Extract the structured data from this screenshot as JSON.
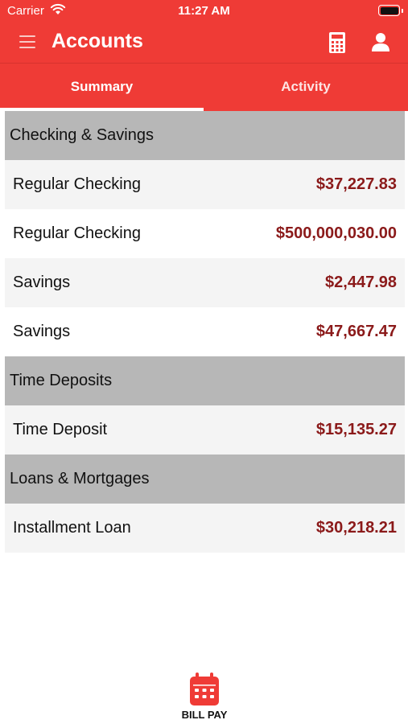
{
  "status_bar": {
    "carrier": "Carrier",
    "time": "11:27 AM"
  },
  "nav": {
    "title": "Accounts"
  },
  "tabs": [
    {
      "label": "Summary",
      "selected": true
    },
    {
      "label": "Activity",
      "selected": false
    }
  ],
  "sections": [
    {
      "title": "Checking & Savings",
      "rows": [
        {
          "name": "Regular Checking",
          "amount": "$37,227.83"
        },
        {
          "name": "Regular Checking",
          "amount": "$500,000,030.00"
        },
        {
          "name": "Savings",
          "amount": "$2,447.98"
        },
        {
          "name": "Savings",
          "amount": "$47,667.47"
        }
      ]
    },
    {
      "title": "Time Deposits",
      "rows": [
        {
          "name": "Time Deposit",
          "amount": "$15,135.27"
        }
      ]
    },
    {
      "title": "Loans & Mortgages",
      "rows": [
        {
          "name": "Installment Loan",
          "amount": "$30,218.21"
        }
      ]
    }
  ],
  "bottom_bar": {
    "bill_pay_label": "BILL PAY"
  },
  "icons": {
    "menu": "hamburger-icon",
    "calculator": "calculator-icon",
    "profile": "user-icon",
    "bill_pay": "calendar-icon",
    "wifi": "wifi-icon",
    "battery": "battery-icon"
  },
  "colors": {
    "brand_red": "#ef3b36",
    "amount": "#8b1a1a",
    "section_bg": "#b7b7b7",
    "row_alt_bg": "#f4f4f4"
  }
}
